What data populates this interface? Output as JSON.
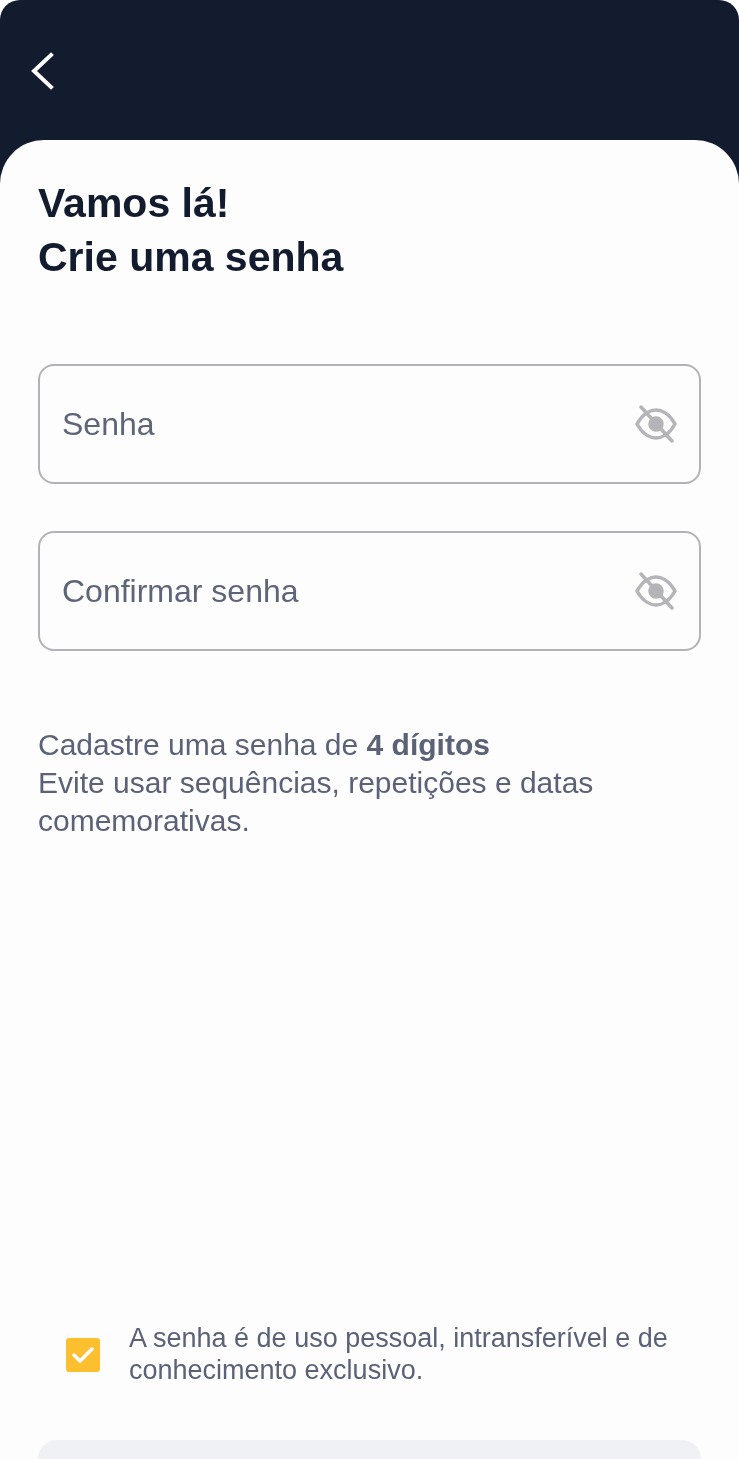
{
  "title": [
    "Vamos lá!",
    "Crie uma senha"
  ],
  "fields": [
    {
      "placeholder": "Senha",
      "revealed": false
    },
    {
      "placeholder": "Confirmar senha",
      "revealed": false
    }
  ],
  "hint": [
    "Cadastre uma senha de **4 dígitos**",
    "Evite usar sequências, repetições e datas comemorativas."
  ],
  "consent": {
    "text": "A senha é de uso pessoal, intransferível e de conhecimento exclusivo.",
    "checked": true
  },
  "submit_button": {
    "disabled": true
  }
}
